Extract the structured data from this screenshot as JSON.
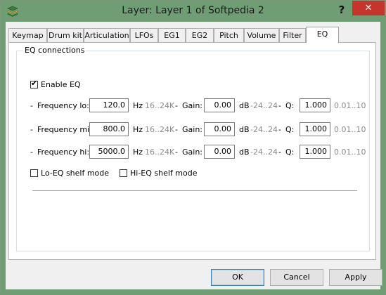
{
  "window": {
    "title": "Layer: Layer 1 of Softpedia 2",
    "help_label": "?",
    "close_label": "✕"
  },
  "tabs": [
    {
      "label": "Keymap",
      "active": false
    },
    {
      "label": "Drum kit",
      "active": false
    },
    {
      "label": "Articulation",
      "active": false
    },
    {
      "label": "LFOs",
      "active": false
    },
    {
      "label": "EG1",
      "active": false
    },
    {
      "label": "EG2",
      "active": false
    },
    {
      "label": "Pitch",
      "active": false
    },
    {
      "label": "Volume",
      "active": false
    },
    {
      "label": "Filter",
      "active": false
    },
    {
      "label": "EQ",
      "active": true
    }
  ],
  "eq": {
    "group_label": "EQ connections",
    "enable_label": "Enable EQ",
    "enable_checked": true,
    "dash": "-",
    "rows": [
      {
        "label": "Frequency lo:",
        "freq": "120.0",
        "hz": "Hz",
        "freq_range": "16..24K",
        "gain_label": "Gain:",
        "gain": "0.00",
        "db": "dB",
        "gain_range": "-24..24",
        "q_label": "Q:",
        "q": "1.000",
        "q_range": "0.01..10"
      },
      {
        "label": "Frequency mi:",
        "freq": "800.0",
        "hz": "Hz",
        "freq_range": "16..24K",
        "gain_label": "Gain:",
        "gain": "0.00",
        "db": "dB",
        "gain_range": "-24..24",
        "q_label": "Q:",
        "q": "1.000",
        "q_range": "0.01..10"
      },
      {
        "label": "Frequency hi:",
        "freq": "5000.0",
        "hz": "Hz",
        "freq_range": "16..24K",
        "gain_label": "Gain:",
        "gain": "0.00",
        "db": "dB",
        "gain_range": "-24..24",
        "q_label": "Q:",
        "q": "1.000",
        "q_range": "0.01..10"
      }
    ],
    "lo_shelf_label": "Lo-EQ shelf mode",
    "lo_shelf_checked": false,
    "hi_shelf_label": "Hi-EQ shelf mode",
    "hi_shelf_checked": false
  },
  "buttons": {
    "ok": "OK",
    "cancel": "Cancel",
    "apply": "Apply"
  },
  "colors": {
    "titlebar": "#6f9e74",
    "close": "#c7342b"
  }
}
